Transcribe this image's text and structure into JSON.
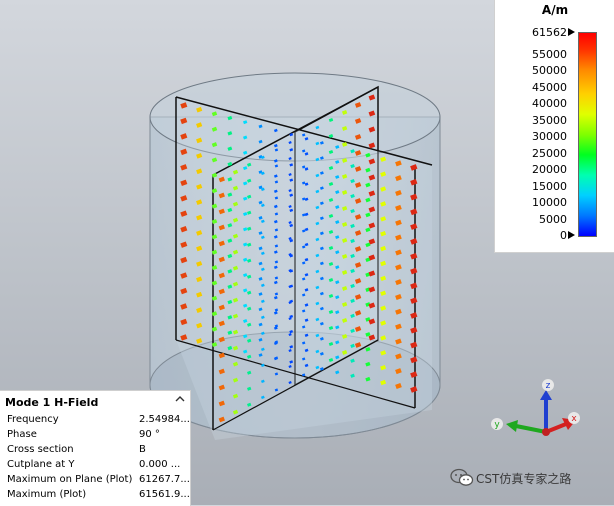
{
  "legend": {
    "unit": "A/m",
    "max_value": "61562",
    "min_value": "0",
    "ticks": [
      "55000",
      "50000",
      "45000",
      "40000",
      "35000",
      "30000",
      "25000",
      "20000",
      "15000",
      "10000",
      "5000"
    ]
  },
  "info_panel": {
    "title": "Mode 1 H-Field",
    "rows": [
      {
        "key": "Frequency",
        "value": "2.54984..."
      },
      {
        "key": "Phase",
        "value": "90 °"
      },
      {
        "key": "Cross section",
        "value": "B"
      },
      {
        "key": "Cutplane at Y",
        "value": "0.000 ..."
      },
      {
        "key": "Maximum on Plane (Plot)",
        "value": "61267.7..."
      },
      {
        "key": "Maximum (Plot)",
        "value": "61561.9..."
      }
    ]
  },
  "axes": {
    "z": "z",
    "y": "y",
    "x": "x"
  },
  "watermark": {
    "text": "CST仿真专家之路"
  },
  "colors": {
    "x_axis": "#d42020",
    "y_axis": "#1fa81f",
    "z_axis": "#1f3fd0"
  },
  "icons": [
    "chevron-up-icon",
    "wechat-icon"
  ]
}
